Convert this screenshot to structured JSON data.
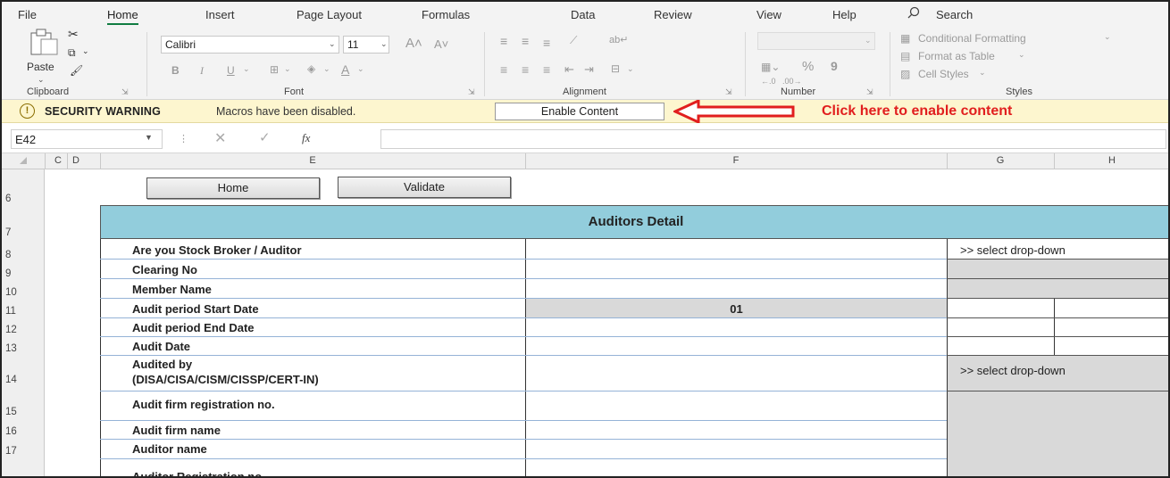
{
  "tabs": [
    "File",
    "Home",
    "Insert",
    "Page Layout",
    "Formulas",
    "Data",
    "Review",
    "View",
    "Help"
  ],
  "search_label": "Search",
  "ribbon": {
    "clipboard": {
      "paste": "Paste",
      "group": "Clipboard"
    },
    "font": {
      "name": "Calibri",
      "size": "11",
      "group": "Font",
      "bold": "B",
      "italic": "I",
      "underline": "U"
    },
    "alignment": {
      "group": "Alignment"
    },
    "number": {
      "group": "Number",
      "percent": "%",
      "comma": "9"
    },
    "styles": {
      "conditional": "Conditional Formatting",
      "format_table": "Format as Table",
      "cell_styles": "Cell Styles",
      "group": "Styles"
    }
  },
  "security": {
    "title": "SECURITY WARNING",
    "message": "Macros have been disabled.",
    "button": "Enable Content",
    "callout": "Click here to enable content"
  },
  "formula_bar": {
    "name_box": "E42",
    "fx": "fx"
  },
  "columns": [
    "C",
    "D",
    "E",
    "F",
    "G",
    "H"
  ],
  "rows": [
    "6",
    "7",
    "8",
    "9",
    "10",
    "11",
    "12",
    "13",
    "14",
    "15",
    "16",
    "17"
  ],
  "sheet": {
    "home_button": "Home",
    "validate_button": "Validate",
    "title": "Auditors Detail",
    "labels": [
      "Are you Stock Broker / Auditor",
      "Clearing No",
      "Member Name",
      "Audit period Start Date",
      "Audit period End Date",
      "Audit Date",
      "Audited by",
      "(DISA/CISA/CISM/CISSP/CERT-IN)",
      "Audit firm registration no.",
      "Audit firm name",
      "Auditor name",
      "Auditor Registration no."
    ],
    "start_date_value": "01",
    "dropdown_hint_1": ">> select drop-down",
    "dropdown_hint_2": ">> select drop-down"
  }
}
